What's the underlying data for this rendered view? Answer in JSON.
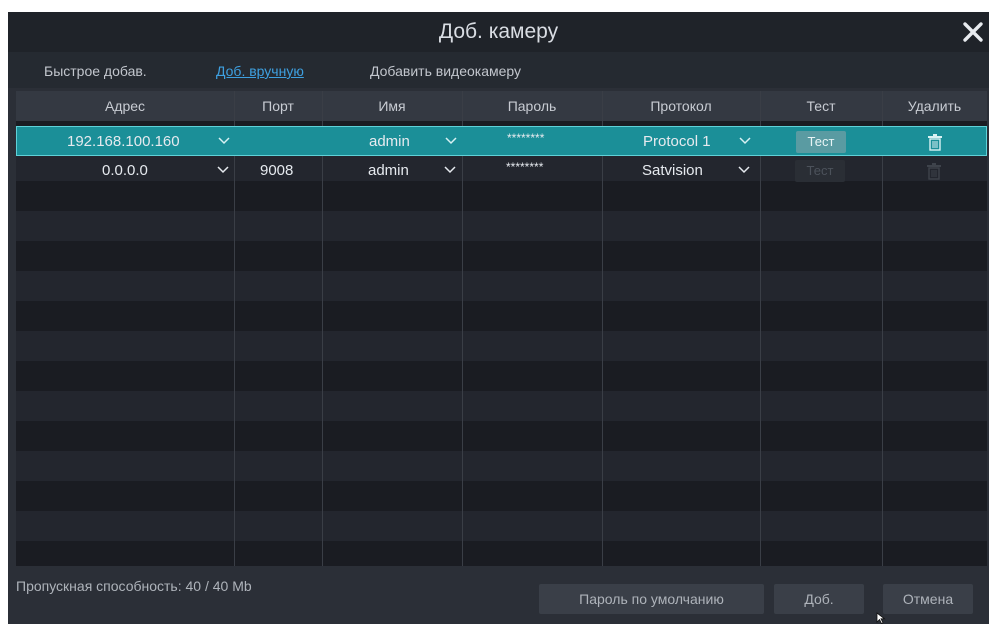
{
  "dialog": {
    "title": "Доб. камеру",
    "close_icon": "close-icon"
  },
  "tabs": [
    {
      "label": "Быстрое добав.",
      "active": false
    },
    {
      "label": "Доб. вручную",
      "active": true
    },
    {
      "label": "Добавить видеокамеру",
      "active": false
    }
  ],
  "table": {
    "columns": [
      "Адрес",
      "Порт",
      "Имя",
      "Пароль",
      "Протокол",
      "Тест",
      "Удалить"
    ],
    "rows": [
      {
        "address": "192.168.100.160",
        "port": "",
        "name": "admin",
        "password": "********",
        "protocol": "Protocol 1",
        "test": "Тест",
        "delete_icon": "trash-icon",
        "selected": true
      },
      {
        "address": "0.0.0.0",
        "port": "9008",
        "name": "admin",
        "password": "********",
        "protocol": "Satvision",
        "test": "Тест",
        "delete_icon": "trash-icon",
        "selected": false
      }
    ]
  },
  "footer": {
    "bandwidth": "Пропускная способность: 40 / 40 Mb",
    "default_password_button": "Пароль по умолчанию",
    "add_button": "Доб.",
    "cancel_button": "Отмена"
  },
  "colors": {
    "selected_row": "#1b8f98",
    "active_tab": "#3ea0e0",
    "dialog_bg": "#2b2f37"
  }
}
